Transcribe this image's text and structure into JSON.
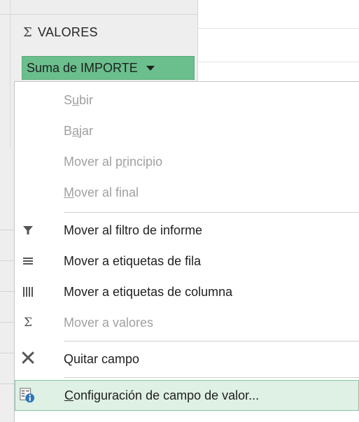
{
  "values_area": {
    "title": "VALORES",
    "sigma_glyph": "Σ",
    "field_chip_label": "Suma de IMPORTE"
  },
  "context_menu": {
    "items": [
      {
        "label_pre": "S",
        "label_u": "u",
        "label_post": "bir",
        "enabled": false,
        "icon": "none"
      },
      {
        "label_pre": "B",
        "label_u": "a",
        "label_post": "jar",
        "enabled": false,
        "icon": "none"
      },
      {
        "label_pre": "Mover al p",
        "label_u": "r",
        "label_post": "incipio",
        "enabled": false,
        "icon": "none"
      },
      {
        "label_pre": "",
        "label_u": "M",
        "label_post": "over al final",
        "enabled": false,
        "icon": "none"
      },
      {
        "label": "Mover al filtro de informe",
        "enabled": true,
        "icon": "filter-icon"
      },
      {
        "label": "Mover a etiquetas de fila",
        "enabled": true,
        "icon": "rows-icon"
      },
      {
        "label": "Mover a etiquetas de columna",
        "enabled": true,
        "icon": "columns-icon"
      },
      {
        "label": "Mover a valores",
        "enabled": false,
        "icon": "sigma-icon",
        "glyph": "Σ"
      },
      {
        "label": "Quitar campo",
        "enabled": true,
        "icon": "close-icon",
        "glyph": "✕"
      },
      {
        "label_pre": "",
        "label_u": "C",
        "label_post": "onfiguración de campo de valor...",
        "enabled": true,
        "icon": "field-settings-icon",
        "highlighted": true
      }
    ]
  },
  "colors": {
    "chip_bg": "#6abf8c",
    "highlight_bg": "#dff0e5",
    "highlight_border": "#86c79d",
    "info_badge": "#2e75b6"
  }
}
